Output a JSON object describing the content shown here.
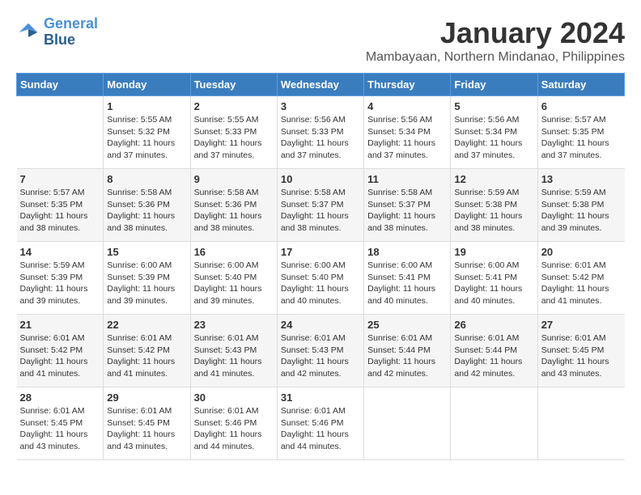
{
  "logo": {
    "line1": "General",
    "line2": "Blue"
  },
  "title": "January 2024",
  "location": "Mambayaan, Northern Mindanao, Philippines",
  "days_of_week": [
    "Sunday",
    "Monday",
    "Tuesday",
    "Wednesday",
    "Thursday",
    "Friday",
    "Saturday"
  ],
  "weeks": [
    [
      {
        "day": "",
        "info": ""
      },
      {
        "day": "1",
        "info": "Sunrise: 5:55 AM\nSunset: 5:32 PM\nDaylight: 11 hours\nand 37 minutes."
      },
      {
        "day": "2",
        "info": "Sunrise: 5:55 AM\nSunset: 5:33 PM\nDaylight: 11 hours\nand 37 minutes."
      },
      {
        "day": "3",
        "info": "Sunrise: 5:56 AM\nSunset: 5:33 PM\nDaylight: 11 hours\nand 37 minutes."
      },
      {
        "day": "4",
        "info": "Sunrise: 5:56 AM\nSunset: 5:34 PM\nDaylight: 11 hours\nand 37 minutes."
      },
      {
        "day": "5",
        "info": "Sunrise: 5:56 AM\nSunset: 5:34 PM\nDaylight: 11 hours\nand 37 minutes."
      },
      {
        "day": "6",
        "info": "Sunrise: 5:57 AM\nSunset: 5:35 PM\nDaylight: 11 hours\nand 37 minutes."
      }
    ],
    [
      {
        "day": "7",
        "info": "Sunrise: 5:57 AM\nSunset: 5:35 PM\nDaylight: 11 hours\nand 38 minutes."
      },
      {
        "day": "8",
        "info": "Sunrise: 5:58 AM\nSunset: 5:36 PM\nDaylight: 11 hours\nand 38 minutes."
      },
      {
        "day": "9",
        "info": "Sunrise: 5:58 AM\nSunset: 5:36 PM\nDaylight: 11 hours\nand 38 minutes."
      },
      {
        "day": "10",
        "info": "Sunrise: 5:58 AM\nSunset: 5:37 PM\nDaylight: 11 hours\nand 38 minutes."
      },
      {
        "day": "11",
        "info": "Sunrise: 5:58 AM\nSunset: 5:37 PM\nDaylight: 11 hours\nand 38 minutes."
      },
      {
        "day": "12",
        "info": "Sunrise: 5:59 AM\nSunset: 5:38 PM\nDaylight: 11 hours\nand 38 minutes."
      },
      {
        "day": "13",
        "info": "Sunrise: 5:59 AM\nSunset: 5:38 PM\nDaylight: 11 hours\nand 39 minutes."
      }
    ],
    [
      {
        "day": "14",
        "info": "Sunrise: 5:59 AM\nSunset: 5:39 PM\nDaylight: 11 hours\nand 39 minutes."
      },
      {
        "day": "15",
        "info": "Sunrise: 6:00 AM\nSunset: 5:39 PM\nDaylight: 11 hours\nand 39 minutes."
      },
      {
        "day": "16",
        "info": "Sunrise: 6:00 AM\nSunset: 5:40 PM\nDaylight: 11 hours\nand 39 minutes."
      },
      {
        "day": "17",
        "info": "Sunrise: 6:00 AM\nSunset: 5:40 PM\nDaylight: 11 hours\nand 40 minutes."
      },
      {
        "day": "18",
        "info": "Sunrise: 6:00 AM\nSunset: 5:41 PM\nDaylight: 11 hours\nand 40 minutes."
      },
      {
        "day": "19",
        "info": "Sunrise: 6:00 AM\nSunset: 5:41 PM\nDaylight: 11 hours\nand 40 minutes."
      },
      {
        "day": "20",
        "info": "Sunrise: 6:01 AM\nSunset: 5:42 PM\nDaylight: 11 hours\nand 41 minutes."
      }
    ],
    [
      {
        "day": "21",
        "info": "Sunrise: 6:01 AM\nSunset: 5:42 PM\nDaylight: 11 hours\nand 41 minutes."
      },
      {
        "day": "22",
        "info": "Sunrise: 6:01 AM\nSunset: 5:42 PM\nDaylight: 11 hours\nand 41 minutes."
      },
      {
        "day": "23",
        "info": "Sunrise: 6:01 AM\nSunset: 5:43 PM\nDaylight: 11 hours\nand 41 minutes."
      },
      {
        "day": "24",
        "info": "Sunrise: 6:01 AM\nSunset: 5:43 PM\nDaylight: 11 hours\nand 42 minutes."
      },
      {
        "day": "25",
        "info": "Sunrise: 6:01 AM\nSunset: 5:44 PM\nDaylight: 11 hours\nand 42 minutes."
      },
      {
        "day": "26",
        "info": "Sunrise: 6:01 AM\nSunset: 5:44 PM\nDaylight: 11 hours\nand 42 minutes."
      },
      {
        "day": "27",
        "info": "Sunrise: 6:01 AM\nSunset: 5:45 PM\nDaylight: 11 hours\nand 43 minutes."
      }
    ],
    [
      {
        "day": "28",
        "info": "Sunrise: 6:01 AM\nSunset: 5:45 PM\nDaylight: 11 hours\nand 43 minutes."
      },
      {
        "day": "29",
        "info": "Sunrise: 6:01 AM\nSunset: 5:45 PM\nDaylight: 11 hours\nand 43 minutes."
      },
      {
        "day": "30",
        "info": "Sunrise: 6:01 AM\nSunset: 5:46 PM\nDaylight: 11 hours\nand 44 minutes."
      },
      {
        "day": "31",
        "info": "Sunrise: 6:01 AM\nSunset: 5:46 PM\nDaylight: 11 hours\nand 44 minutes."
      },
      {
        "day": "",
        "info": ""
      },
      {
        "day": "",
        "info": ""
      },
      {
        "day": "",
        "info": ""
      }
    ]
  ]
}
